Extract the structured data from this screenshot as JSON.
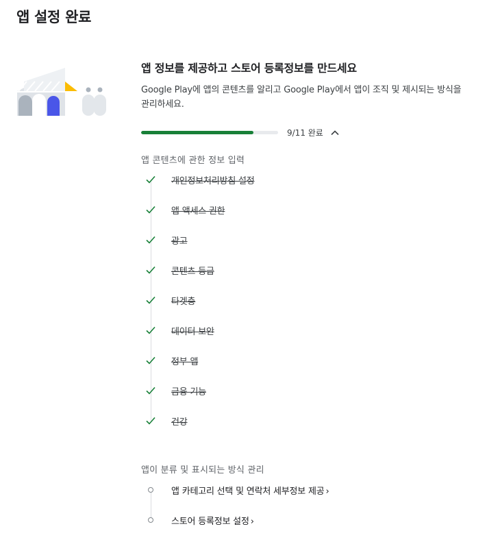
{
  "page": {
    "title": "앱 설정 완료"
  },
  "section": {
    "heading": "앱 정보를 제공하고 스토어 등록정보를 만드세요",
    "description_line1": "Google Play에 앱의 콘텐츠를 알리고 Google Play에서 앱이 조직 및 제시되는 방식을",
    "description_line2": "관리하세요."
  },
  "progress": {
    "completed": 9,
    "total": 11,
    "label": "9/11 완료",
    "fill_color": "#188038",
    "toggle_icon": "chevron-up-icon"
  },
  "groups": [
    {
      "title": "앱 콘텐츠에 관한 정보 입력",
      "tasks": [
        {
          "label": "개인정보처리방침 설정",
          "done": true
        },
        {
          "label": "앱 액세스 권한",
          "done": true
        },
        {
          "label": "광고",
          "done": true
        },
        {
          "label": "콘텐츠 등급",
          "done": true
        },
        {
          "label": "타겟층",
          "done": true
        },
        {
          "label": "데이터 보안",
          "done": true
        },
        {
          "label": "정부 앱",
          "done": true
        },
        {
          "label": "금융 기능",
          "done": true
        },
        {
          "label": "건강",
          "done": true
        }
      ]
    },
    {
      "title": "앱이 분류 및 표시되는 방식 관리",
      "tasks": [
        {
          "label": "앱 카테고리 선택 및 연락처 세부정보 제공",
          "done": false
        },
        {
          "label": "스토어 등록정보 설정",
          "done": false
        }
      ]
    }
  ],
  "icons": {
    "check": "check-icon",
    "pending": "circle-icon",
    "link_arrow": "chevron-right-icon"
  },
  "colors": {
    "check": "#188038",
    "accent_blue": "#4a56e8",
    "accent_yellow": "#fbbc04"
  }
}
